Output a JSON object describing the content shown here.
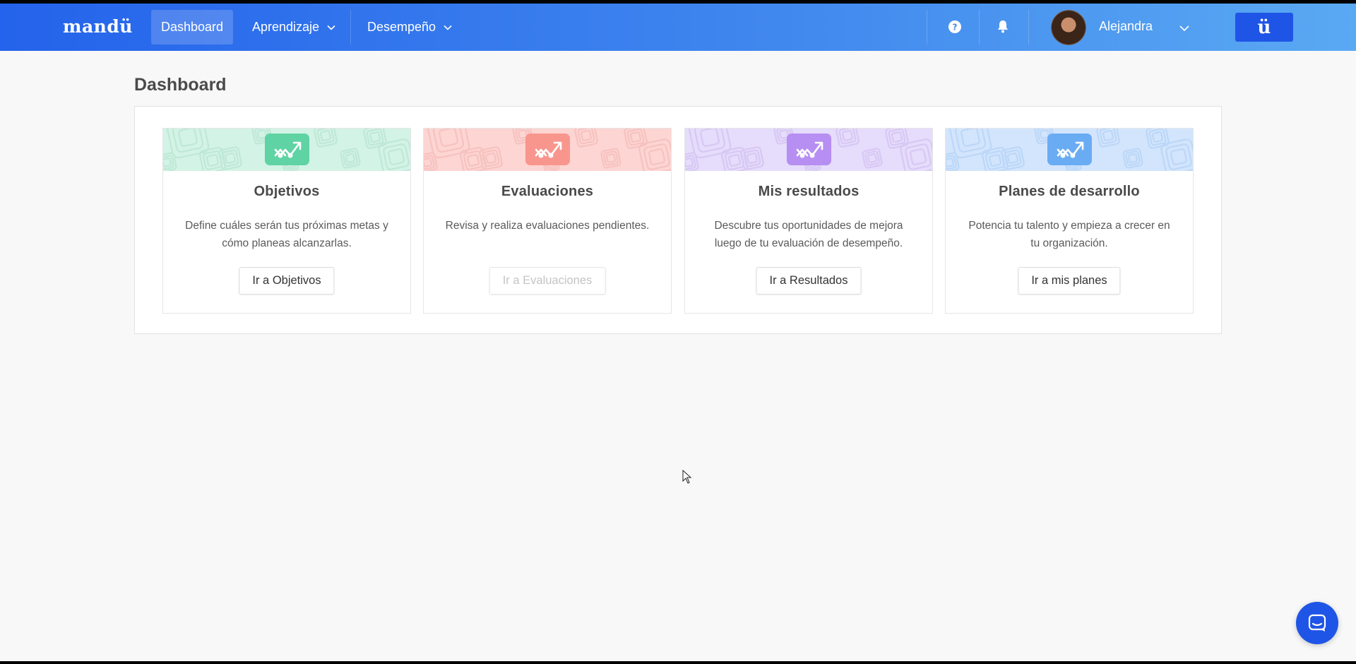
{
  "header": {
    "logo": "mandü",
    "nav": [
      {
        "label": "Dashboard",
        "active": true,
        "has_dropdown": false
      },
      {
        "label": "Aprendizaje",
        "active": false,
        "has_dropdown": true
      },
      {
        "label": "Desempeño",
        "active": false,
        "has_dropdown": true
      }
    ],
    "icons": [
      "help-icon",
      "bell-icon"
    ],
    "user": {
      "name": "Alejandra",
      "avatar": "user-avatar"
    },
    "brand_button": "ü"
  },
  "colors": {
    "header_gradient_start": "#2463eb",
    "header_gradient_end": "#5aa9f3",
    "brand_blue": "#1f55e6"
  },
  "page": {
    "title": "Dashboard"
  },
  "cards": [
    {
      "title": "Objetivos",
      "description": "Define cuáles serán tus próximas metas y cómo planeas alcanzarlas.",
      "button": "Ir a Objetivos",
      "button_enabled": true,
      "banner_color": "#d3f3e6",
      "icon_color": "#5fd3a3",
      "pattern_color": "#bfe8d6"
    },
    {
      "title": "Evaluaciones",
      "description": "Revisa y realiza evaluaciones pendientes.",
      "button": "Ir a Evaluaciones",
      "button_enabled": false,
      "banner_color": "#fdd5d3",
      "icon_color": "#f8968d",
      "pattern_color": "#f6c2bf"
    },
    {
      "title": "Mis resultados",
      "description": "Descubre tus oportunidades de mejora luego de tu evaluación de desempeño.",
      "button": "Ir a Resultados",
      "button_enabled": true,
      "banner_color": "#e6dcfb",
      "icon_color": "#b78ef2",
      "pattern_color": "#d7c8f4"
    },
    {
      "title": "Planes de desarrollo",
      "description": "Potencia tu talento y empieza a crecer en tu organización.",
      "button": "Ir a mis planes",
      "button_enabled": true,
      "banner_color": "#d2e5fd",
      "icon_color": "#6aacf3",
      "pattern_color": "#bcd7f7"
    }
  ],
  "chat": {
    "icon": "chat-icon"
  }
}
